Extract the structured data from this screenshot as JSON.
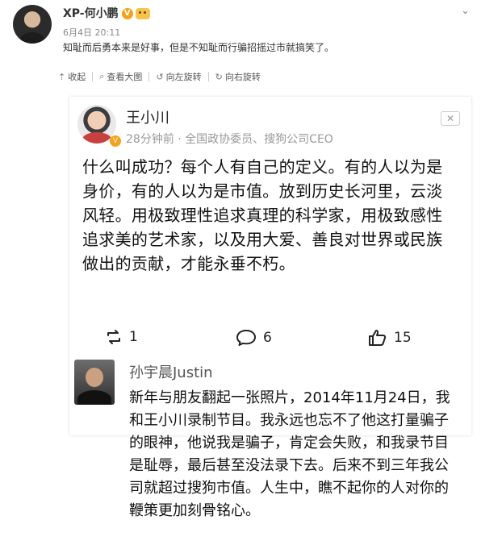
{
  "post": {
    "author": "XP-何小鹏",
    "time": "6月4日 20:11",
    "text": "知耻而后勇本来是好事，但是不知耻而行骗招摇过市就搞笑了。"
  },
  "toolbar": {
    "collapse": "收起",
    "view_large": "查看大图",
    "rotate_left": "向左旋转",
    "rotate_right": "向右旋转"
  },
  "screenshot_card": {
    "name": "王小川",
    "meta": "28分钟前 · 全国政协委员、搜狗公司CEO",
    "body": "什么叫成功？每个人有自己的定义。有的人以为是身价，有的人以为是市值。放到历史长河里，云淡风轻。用极致理性追求真理的科学家，用极致感性追求美的艺术家，以及用大爱、善良对世界或民族做出的贡献，才能永垂不朽。",
    "reposts": "1",
    "comments": "6",
    "likes": "15"
  },
  "reply": {
    "name": "孙宇晨Justin",
    "body": "新年与朋友翻起一张照片，2014年11月24日，我和王小川录制节目。我永远也忘不了他这打量骗子的眼神，他说我是骗子，肯定会失败，和我录节目是耻辱，最后甚至没法录下去。后来不到三年我公司就超过搜狗市值。人生中，瞧不起你的人对你的鞭策更加刻骨铭心。"
  },
  "colors": {
    "badge": "#f7a11b",
    "meta_gray": "#999999",
    "comment_bg": "#f3f3f3"
  }
}
